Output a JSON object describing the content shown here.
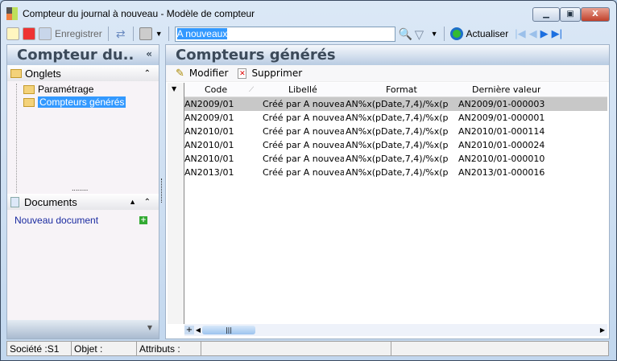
{
  "window": {
    "title": "Compteur du journal à nouveau -  Modèle de compteur"
  },
  "toolbar": {
    "save_label": "Enregistrer",
    "search_value": "A nouveaux",
    "refresh_label": "Actualiser"
  },
  "left": {
    "title": "Compteur du..",
    "collapse": "«",
    "tabs_section": "Onglets",
    "tree": [
      "Paramétrage",
      "Compteurs générés"
    ],
    "documents_section": "Documents",
    "new_document": "Nouveau document"
  },
  "right": {
    "title": "Compteurs générés",
    "modify_label": "Modifier",
    "delete_label": "Supprimer",
    "columns": [
      "Code",
      "Libellé",
      "Format",
      "Dernière valeur"
    ],
    "rows": [
      [
        "AN2009/01",
        "Créé par A nouveaux",
        "AN%x(pDate,7,4)/%x(p",
        "AN2009/01-000003"
      ],
      [
        "AN2009/01",
        "Créé par A nouveaux",
        "AN%x(pDate,7,4)/%x(p",
        "AN2009/01-000001"
      ],
      [
        "AN2010/01",
        "Créé par A nouveaux",
        "AN%x(pDate,7,4)/%x(p",
        "AN2010/01-000114"
      ],
      [
        "AN2010/01",
        "Créé par A nouveaux",
        "AN%x(pDate,7,4)/%x(p",
        "AN2010/01-000024"
      ],
      [
        "AN2010/01",
        "Créé par A nouveaux",
        "AN%x(pDate,7,4)/%x(p",
        "AN2010/01-000010"
      ],
      [
        "AN2013/01",
        "Créé par A nouveaux",
        "AN%x(pDate,7,4)/%x(p",
        "AN2013/01-000016"
      ]
    ]
  },
  "status": {
    "societe": "Société :S1",
    "objet": "Objet :",
    "attributs": "Attributs :"
  }
}
